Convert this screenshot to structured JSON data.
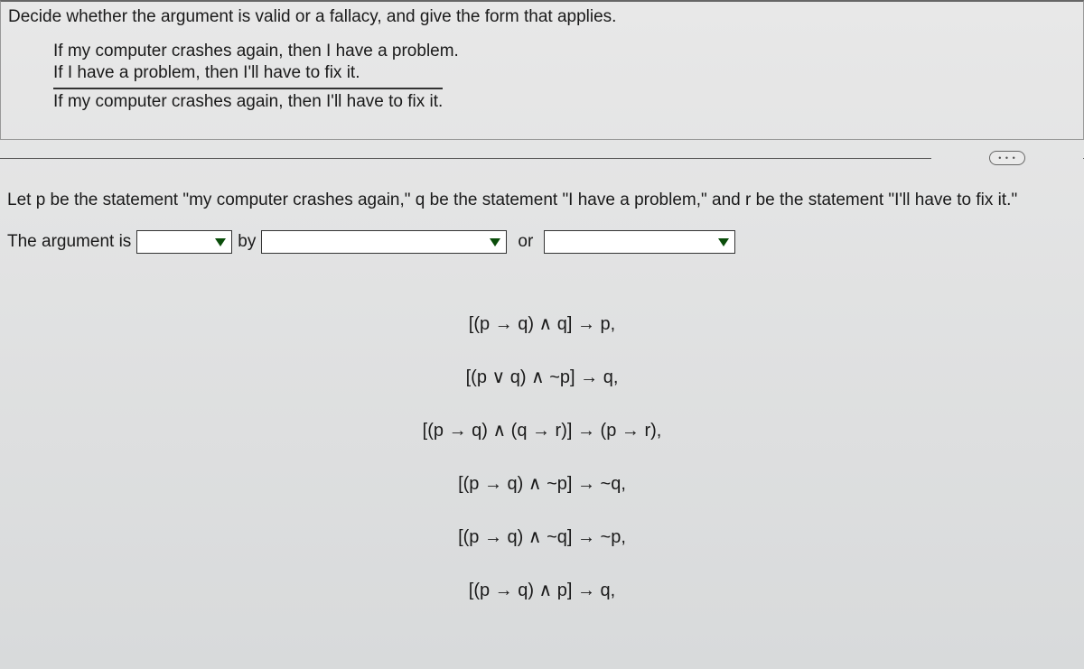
{
  "question": {
    "prompt": "Decide whether the argument is valid or a fallacy, and give the form that applies.",
    "premise1": "If my computer crashes again, then I have a problem.",
    "premise2": "If I have a problem, then I'll have to fix it.",
    "conclusion": "If my computer crashes again, then I'll have to fix it."
  },
  "ellipsis": "• • •",
  "setup": "Let p be the statement \"my computer crashes again,\" q be the statement \"I have a problem,\" and r be the statement \"I'll have to fix it.\"",
  "answerRow": {
    "lead": "The argument is",
    "by": "by",
    "or": "or"
  },
  "formulas": {
    "f1": "[(p → q) ∧ q] → p,",
    "f2": "[(p ∨ q) ∧ ~p] → q,",
    "f3": "[(p → q) ∧ (q → r)] → (p → r),",
    "f4": "[(p → q) ∧ ~p] → ~q,",
    "f5": "[(p → q) ∧ ~q] → ~p,",
    "f6": "[(p → q) ∧ p] → q,"
  }
}
